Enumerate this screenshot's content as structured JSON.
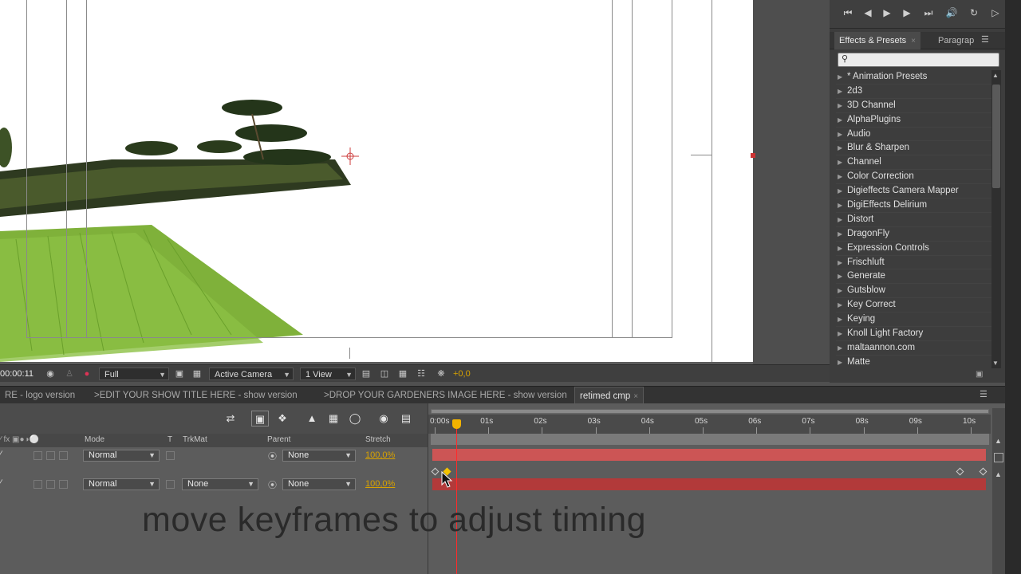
{
  "viewer": {
    "timecode": "00:00:11",
    "resolution": "Full",
    "camera": "Active Camera",
    "views": "1 View",
    "exposure": "+0,0"
  },
  "preview": {
    "buttons": [
      "first-frame",
      "prev-frame",
      "play",
      "next-frame",
      "last-frame",
      "audio",
      "loop",
      "ram-preview"
    ]
  },
  "effects_panel": {
    "tabs": [
      "Effects & Presets",
      "Paragrap"
    ],
    "search_placeholder": "",
    "items": [
      "* Animation Presets",
      "2d3",
      "3D Channel",
      "AlphaPlugins",
      "Audio",
      "Blur & Sharpen",
      "Channel",
      "Color Correction",
      "Digieffects Camera Mapper",
      "DigiEffects Delirium",
      "Distort",
      "DragonFly",
      "Expression Controls",
      "Frischluft",
      "Generate",
      "Gutsblow",
      "Key Correct",
      "Keying",
      "Knoll Light Factory",
      "maltaannon.com",
      "Matte"
    ]
  },
  "timeline": {
    "tabs": [
      "RE - logo version",
      ">EDIT YOUR SHOW TITLE HERE - show version",
      ">DROP YOUR GARDENERS IMAGE HERE - show version",
      "retimed cmp"
    ],
    "columns": {
      "mode": "Mode",
      "t": "T",
      "trkmat": "TrkMat",
      "parent": "Parent",
      "stretch": "Stretch"
    },
    "ruler": [
      "0:00s",
      "01s",
      "02s",
      "03s",
      "04s",
      "05s",
      "06s",
      "07s",
      "08s",
      "09s",
      "10s"
    ],
    "layers": [
      {
        "mode": "Normal",
        "trkmat": "",
        "parent": "None",
        "stretch": "100,0%"
      },
      {
        "mode": "Normal",
        "trkmat": "None",
        "parent": "None",
        "stretch": "100,0%"
      }
    ],
    "current_time_fraction": 0.05
  },
  "caption": "move keyframes  to adjust timing",
  "colors": {
    "layer1_bar": "#cc5555",
    "layer2_bar": "#b23a3a",
    "cti": "#ff2a2a",
    "accent": "#d8a200"
  }
}
